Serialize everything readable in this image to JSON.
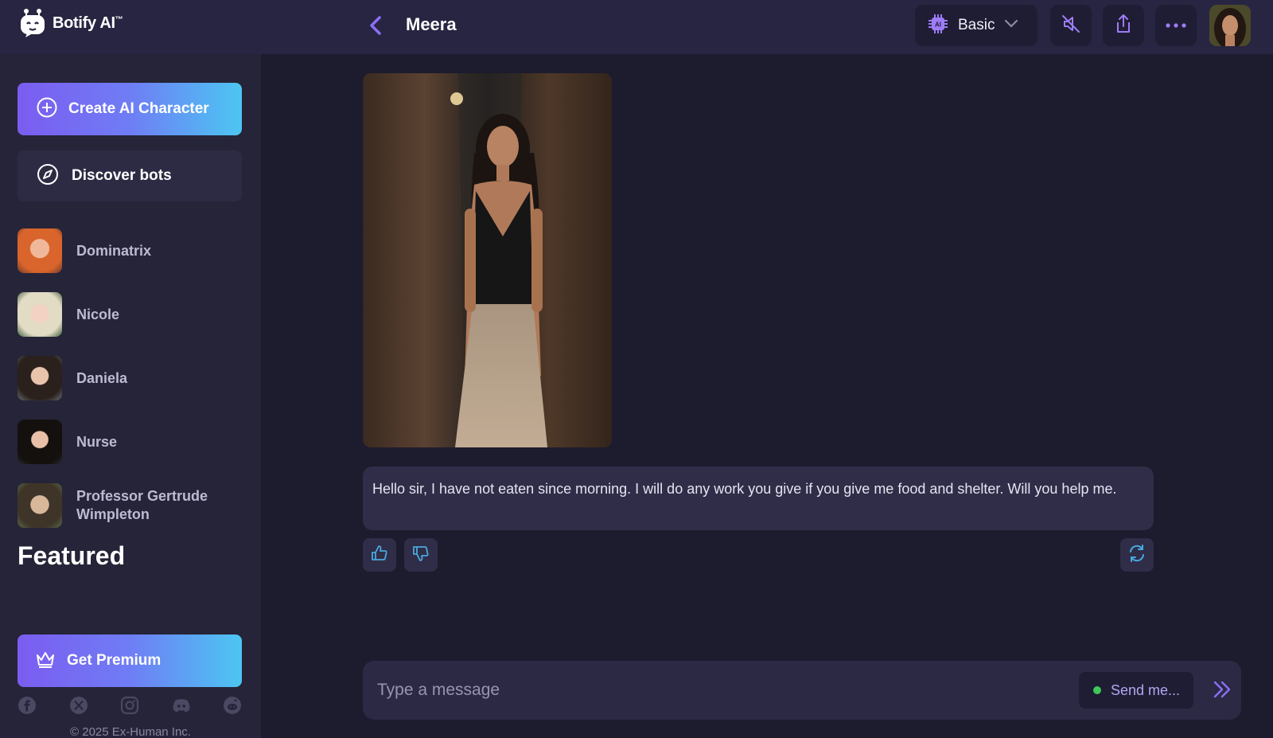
{
  "header": {
    "logo_text": "Botify AI",
    "logo_tm": "™",
    "chat_title": "Meera",
    "model_label": "Basic"
  },
  "sidebar": {
    "create_label": "Create AI Character",
    "discover_label": "Discover bots",
    "bots": [
      {
        "name": "Dominatrix"
      },
      {
        "name": "Nicole"
      },
      {
        "name": "Daniela"
      },
      {
        "name": "Nurse"
      },
      {
        "name": "Professor Gertrude Wimpleton"
      }
    ],
    "featured_heading": "Featured",
    "premium_label": "Get Premium",
    "copyright": "© 2025 Ex-Human Inc."
  },
  "chat": {
    "message": "Hello sir, I have not eaten since morning. I will do any work you give if you give me food and shelter. Will you help me."
  },
  "composer": {
    "placeholder": "Type a message",
    "send_mode_label": "Send me..."
  },
  "colors": {
    "accent_start": "#7b5cf0",
    "accent_end": "#4cc6f2",
    "online": "#3ec85a"
  }
}
